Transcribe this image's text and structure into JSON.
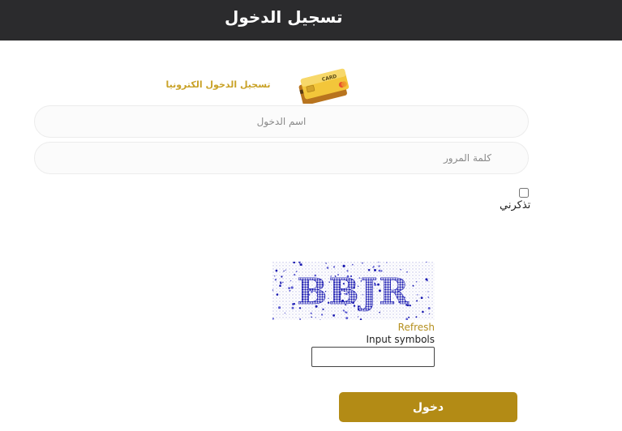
{
  "header": {
    "title": "تسجيل الدخول"
  },
  "login_card": {
    "title": "تسجيل الدخول الكترونيا",
    "card_icon_text": "CARD"
  },
  "form": {
    "username_placeholder": "اسم الدخول",
    "password_placeholder": "كلمة المرور",
    "remember_label": "تذكرني",
    "remember_checked": false
  },
  "captcha": {
    "image_text": "BBJR",
    "refresh_label": "Refresh",
    "input_label": "Input symbols",
    "input_value": ""
  },
  "submit": {
    "label": "دخول"
  },
  "colors": {
    "header_bg": "#2b2b2d",
    "accent": "#b38b15",
    "link": "#b5901f"
  }
}
